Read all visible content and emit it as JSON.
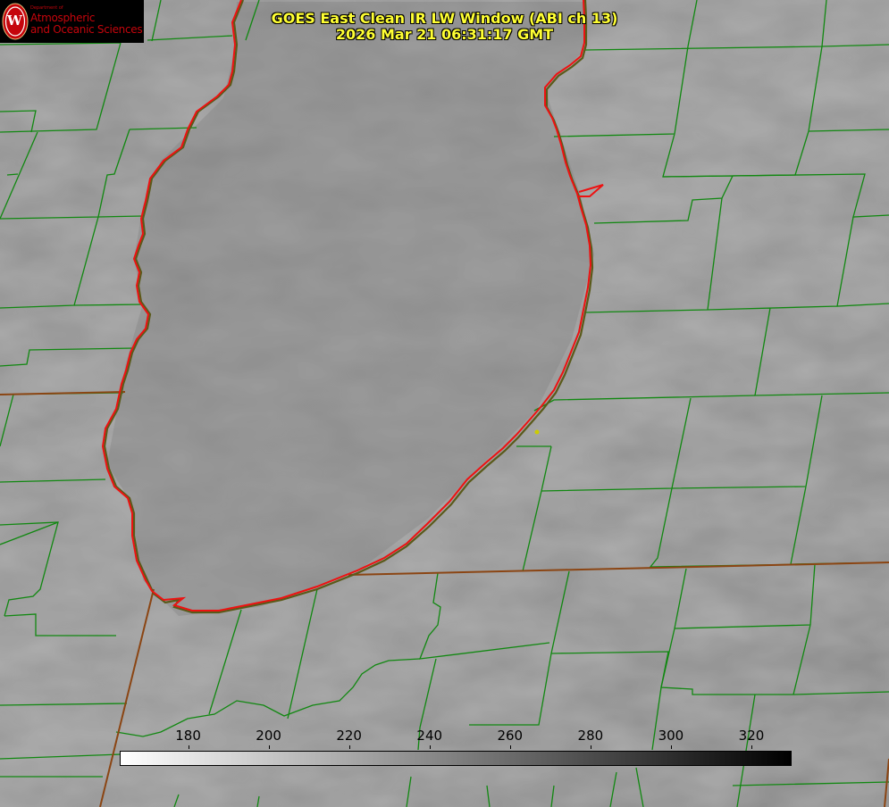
{
  "title": {
    "line1": "GOES East Clean IR LW Window (ABI ch 13)",
    "line2": "2026 Mar 21 06:31:17 GMT"
  },
  "logo": {
    "department": "Department of",
    "line1": "Atmospheric",
    "line2": "and Oceanic Sciences",
    "seal_letter": "W",
    "color": "#c5050c"
  },
  "colorbar": {
    "min": 163,
    "max": 330,
    "ticks": [
      "180",
      "200",
      "220",
      "240",
      "260",
      "280",
      "300",
      "320"
    ],
    "colormap": "grayscale, white (cold) to black (warm)"
  },
  "map": {
    "lake_outline_color": "#ee1111",
    "boundary_color": "#118811",
    "state_line_color": "#8b4513",
    "station_marker_color": "#cccc00"
  }
}
